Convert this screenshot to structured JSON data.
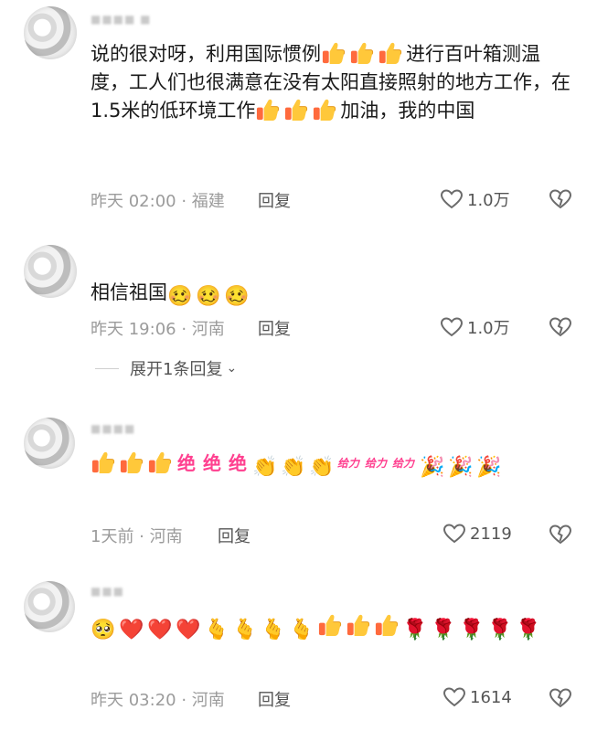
{
  "comments": [
    {
      "text_parts": [
        "说的很对呀，利用国际惯例",
        "进行百叶箱测温度，工人们也很满意在没有太阳直接照射的地方工作，在1.5米的低环境工作",
        "加油，我的中国"
      ],
      "time": "昨天 02:00 · 福建",
      "reply_label": "回复",
      "likes": "1.0万"
    },
    {
      "text": "相信祖国",
      "time": "昨天 19:06 · 河南",
      "reply_label": "回复",
      "likes": "1.0万",
      "expand_label": "展开1条回复"
    },
    {
      "jue": "绝",
      "geili": "给力",
      "time": "1天前 · 河南",
      "reply_label": "回复",
      "likes": "2119"
    },
    {
      "time": "昨天 03:20 · 河南",
      "reply_label": "回复",
      "likes": "1614"
    }
  ],
  "icons": {
    "thumb": "thumbs-up-emoji",
    "like": "heart-outline-icon",
    "dislike": "broken-heart-outline-icon",
    "chevron": "chevron-down-icon"
  },
  "colors": {
    "accent_pink": "#ff3f8f",
    "meta_gray": "#9b9b9b"
  }
}
